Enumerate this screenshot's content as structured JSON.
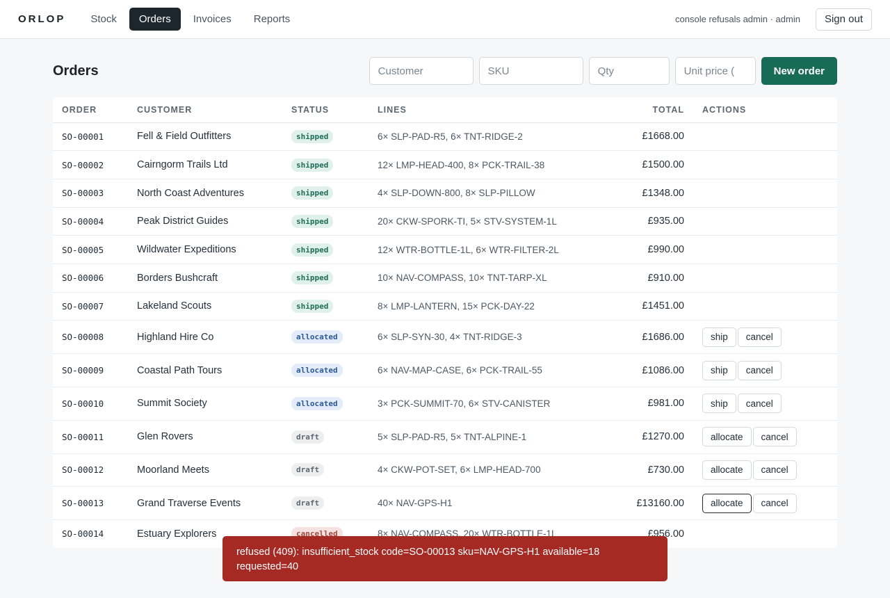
{
  "app": {
    "brand": "ORLOP"
  },
  "nav": [
    {
      "label": "Stock",
      "active": false
    },
    {
      "label": "Orders",
      "active": true
    },
    {
      "label": "Invoices",
      "active": false
    },
    {
      "label": "Reports",
      "active": false
    }
  ],
  "user": {
    "label": "console refusals admin · admin",
    "signout": "Sign out"
  },
  "page": {
    "title": "Orders"
  },
  "form": {
    "customer_placeholder": "Customer",
    "sku_placeholder": "SKU",
    "qty_placeholder": "Qty",
    "price_placeholder": "Unit price (",
    "submit_label": "New order"
  },
  "table": {
    "headers": [
      "ORDER",
      "CUSTOMER",
      "STATUS",
      "LINES",
      "TOTAL",
      "ACTIONS"
    ],
    "rows": [
      {
        "order": "SO-00001",
        "customer": "Fell & Field Outfitters",
        "status": "shipped",
        "lines": "6× SLP-PAD-R5, 6× TNT-RIDGE-2",
        "total": "£1668.00",
        "actions": []
      },
      {
        "order": "SO-00002",
        "customer": "Cairngorm Trails Ltd",
        "status": "shipped",
        "lines": "12× LMP-HEAD-400, 8× PCK-TRAIL-38",
        "total": "£1500.00",
        "actions": []
      },
      {
        "order": "SO-00003",
        "customer": "North Coast Adventures",
        "status": "shipped",
        "lines": "4× SLP-DOWN-800, 8× SLP-PILLOW",
        "total": "£1348.00",
        "actions": []
      },
      {
        "order": "SO-00004",
        "customer": "Peak District Guides",
        "status": "shipped",
        "lines": "20× CKW-SPORK-TI, 5× STV-SYSTEM-1L",
        "total": "£935.00",
        "actions": []
      },
      {
        "order": "SO-00005",
        "customer": "Wildwater Expeditions",
        "status": "shipped",
        "lines": "12× WTR-BOTTLE-1L, 6× WTR-FILTER-2L",
        "total": "£990.00",
        "actions": []
      },
      {
        "order": "SO-00006",
        "customer": "Borders Bushcraft",
        "status": "shipped",
        "lines": "10× NAV-COMPASS, 10× TNT-TARP-XL",
        "total": "£910.00",
        "actions": []
      },
      {
        "order": "SO-00007",
        "customer": "Lakeland Scouts",
        "status": "shipped",
        "lines": "8× LMP-LANTERN, 15× PCK-DAY-22",
        "total": "£1451.00",
        "actions": []
      },
      {
        "order": "SO-00008",
        "customer": "Highland Hire Co",
        "status": "allocated",
        "lines": "6× SLP-SYN-30, 4× TNT-RIDGE-3",
        "total": "£1686.00",
        "actions": [
          "ship",
          "cancel"
        ]
      },
      {
        "order": "SO-00009",
        "customer": "Coastal Path Tours",
        "status": "allocated",
        "lines": "6× NAV-MAP-CASE, 6× PCK-TRAIL-55",
        "total": "£1086.00",
        "actions": [
          "ship",
          "cancel"
        ]
      },
      {
        "order": "SO-00010",
        "customer": "Summit Society",
        "status": "allocated",
        "lines": "3× PCK-SUMMIT-70, 6× STV-CANISTER",
        "total": "£981.00",
        "actions": [
          "ship",
          "cancel"
        ]
      },
      {
        "order": "SO-00011",
        "customer": "Glen Rovers",
        "status": "draft",
        "lines": "5× SLP-PAD-R5, 5× TNT-ALPINE-1",
        "total": "£1270.00",
        "actions": [
          "allocate",
          "cancel"
        ]
      },
      {
        "order": "SO-00012",
        "customer": "Moorland Meets",
        "status": "draft",
        "lines": "4× CKW-POT-SET, 6× LMP-HEAD-700",
        "total": "£730.00",
        "actions": [
          "allocate",
          "cancel"
        ]
      },
      {
        "order": "SO-00013",
        "customer": "Grand Traverse Events",
        "status": "draft",
        "lines": "40× NAV-GPS-H1",
        "total": "£13160.00",
        "actions": [
          "allocate",
          "cancel"
        ],
        "focused_action": "allocate"
      },
      {
        "order": "SO-00014",
        "customer": "Estuary Explorers",
        "status": "cancelled",
        "lines": "8× NAV-COMPASS, 20× WTR-BOTTLE-1L",
        "total": "£956.00",
        "actions": []
      }
    ]
  },
  "toast": {
    "message": "refused (409): insufficient_stock code=SO-00013 sku=NAV-GPS-H1 available=18 requested=40"
  },
  "colors": {
    "accent": "#186b57",
    "nav_active": "#1d262d",
    "error": "#a52a24"
  }
}
